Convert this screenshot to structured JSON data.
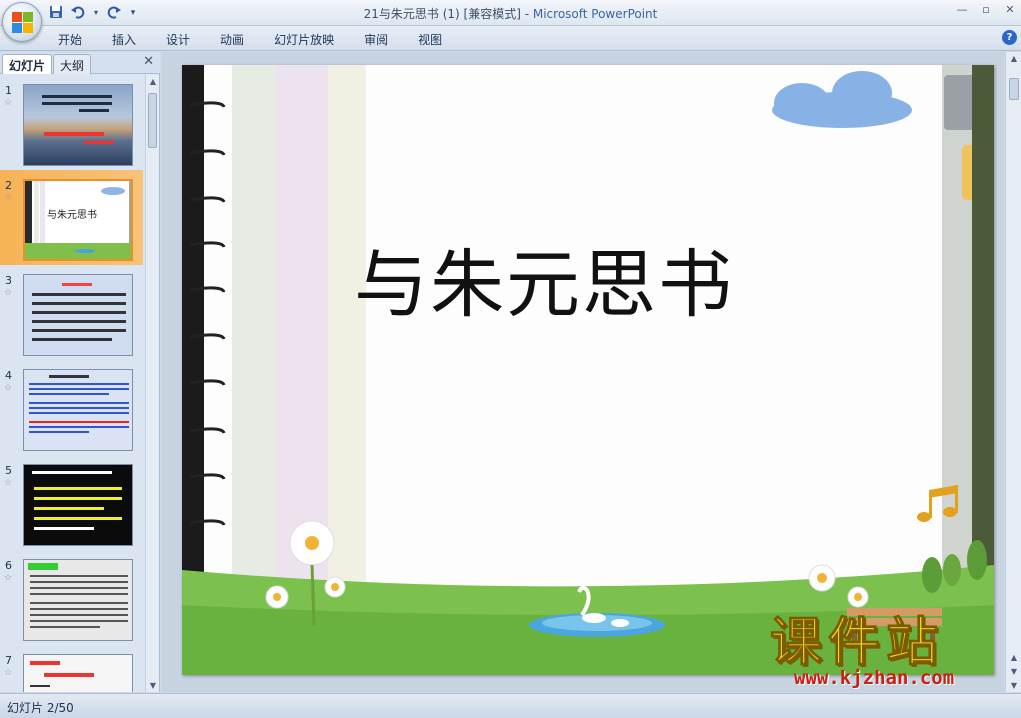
{
  "window": {
    "title": "21与朱元思书 (1) [兼容模式] - ",
    "app_name": "Microsoft PowerPoint"
  },
  "ribbon": {
    "tabs": [
      "开始",
      "插入",
      "设计",
      "动画",
      "幻灯片放映",
      "审阅",
      "视图"
    ]
  },
  "left_pane": {
    "tab_slides": "幻灯片",
    "tab_outline": "大纲",
    "slides": [
      {
        "num": "1"
      },
      {
        "num": "2",
        "text": "与朱元思书"
      },
      {
        "num": "3"
      },
      {
        "num": "4"
      },
      {
        "num": "5"
      },
      {
        "num": "6"
      },
      {
        "num": "7"
      }
    ]
  },
  "slide": {
    "title": "与朱元思书"
  },
  "status": {
    "slide_indicator": "幻灯片 2/50"
  },
  "watermark": {
    "logo": "课件站",
    "url": "www.kjzhan.com"
  },
  "colors": {
    "selected_thumb": "#f6b356",
    "ribbon": "#d4dfec",
    "watermark_yellow": "#f7d21a",
    "watermark_red": "#c72114"
  }
}
